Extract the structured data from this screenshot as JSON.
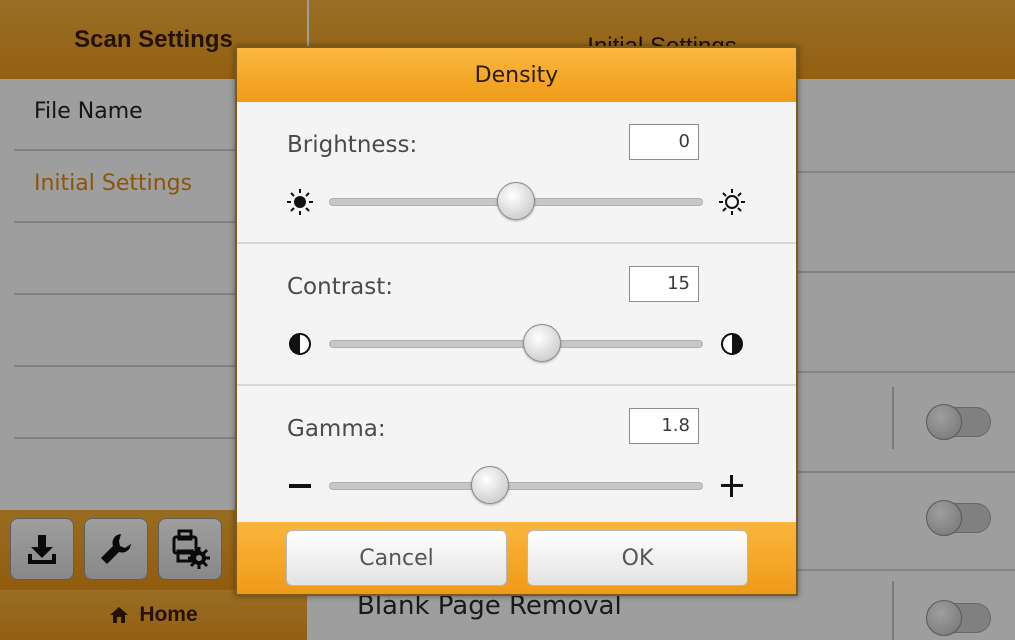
{
  "left_panel": {
    "title": "Scan Settings",
    "items": [
      {
        "label": "File Name",
        "active": false
      },
      {
        "label": "Initial Settings",
        "active": true
      },
      {
        "label": ""
      },
      {
        "label": ""
      },
      {
        "label": ""
      }
    ],
    "tools": [
      {
        "icon": "download-icon"
      },
      {
        "icon": "wrench-icon"
      },
      {
        "icon": "scanner-settings-icon"
      }
    ],
    "home_label": "Home"
  },
  "right_panel": {
    "title": "Initial Settings",
    "blank_page_label": "Blank Page Removal",
    "toggles": [
      false,
      false,
      false
    ]
  },
  "dialog": {
    "title": "Density",
    "brightness": {
      "label": "Brightness:",
      "value": "0",
      "level": 0.5
    },
    "contrast": {
      "label": "Contrast:",
      "value": "15",
      "level": 0.57
    },
    "gamma": {
      "label": "Gamma:",
      "value": "1.8",
      "level": 0.43
    },
    "cancel_label": "Cancel",
    "ok_label": "OK"
  },
  "colors": {
    "accent": "#f0a020",
    "active_text": "#e08a10"
  }
}
